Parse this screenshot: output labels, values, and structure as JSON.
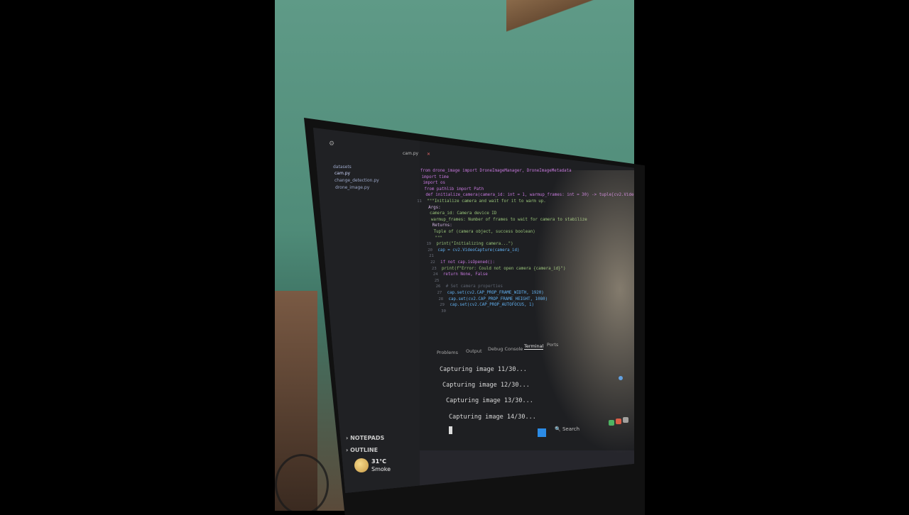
{
  "editor": {
    "tab_label": "cam.py",
    "explorer_files": [
      "datasets",
      "cam.py",
      "change_detection.py",
      "drone_image.py"
    ],
    "code_lines": [
      {
        "num": "",
        "text": "from drone_image import DroneImageManager, DroneImageMetadata"
      },
      {
        "num": "",
        "text": "import time"
      },
      {
        "num": "",
        "text": "import os"
      },
      {
        "num": "",
        "text": "from pathlib import Path"
      },
      {
        "num": "",
        "text": "def initialize_camera(camera_id: int = 1, warmup_frames: int = 30) -> tuple[cv2.VideoCapture, bool]:"
      },
      {
        "num": "11",
        "text": "    \"\"\"Initialize camera and wait for it to warm up."
      },
      {
        "num": "",
        "text": "    Args:"
      },
      {
        "num": "",
        "text": "        camera_id: Camera device ID"
      },
      {
        "num": "",
        "text": "        warmup_frames: Number of frames to wait for camera to stabilize"
      },
      {
        "num": "",
        "text": "    Returns:"
      },
      {
        "num": "",
        "text": "        Tuple of (camera object, success boolean)"
      },
      {
        "num": "",
        "text": "    \"\"\""
      },
      {
        "num": "19",
        "text": "    print(\"Initializing camera...\")"
      },
      {
        "num": "20",
        "text": "    cap = cv2.VideoCapture(camera_id)"
      },
      {
        "num": "21",
        "text": ""
      },
      {
        "num": "22",
        "text": "    if not cap.isOpened():"
      },
      {
        "num": "23",
        "text": "        print(f\"Error: Could not open camera {camera_id}\")"
      },
      {
        "num": "24",
        "text": "        return None, False"
      },
      {
        "num": "25",
        "text": ""
      },
      {
        "num": "26",
        "text": "    # Set camera properties"
      },
      {
        "num": "27",
        "text": "    cap.set(cv2.CAP_PROP_FRAME_WIDTH, 1920)"
      },
      {
        "num": "28",
        "text": "    cap.set(cv2.CAP_PROP_FRAME_HEIGHT, 1080)"
      },
      {
        "num": "29",
        "text": "    cap.set(cv2.CAP_PROP_AUTOFOCUS, 1)"
      },
      {
        "num": "30",
        "text": ""
      }
    ]
  },
  "panel": {
    "tabs": [
      "Problems",
      "Output",
      "Debug Console",
      "Terminal",
      "Ports"
    ],
    "active_tab": "Terminal",
    "terminal_lines": [
      "Capturing image 11/30...",
      "Capturing image 12/30...",
      "Capturing image 13/30...",
      "Capturing image 14/30..."
    ]
  },
  "sidebar_sections": {
    "notepads": "NOTEPADS",
    "outline": "OUTLINE"
  },
  "taskbar": {
    "weather_temp": "31°C",
    "weather_desc": "Smoke",
    "search_placeholder": "Search"
  },
  "colors": {
    "wall": "#4f8b78",
    "editor_bg": "#1e1f22",
    "accent": "#2b8be6"
  }
}
